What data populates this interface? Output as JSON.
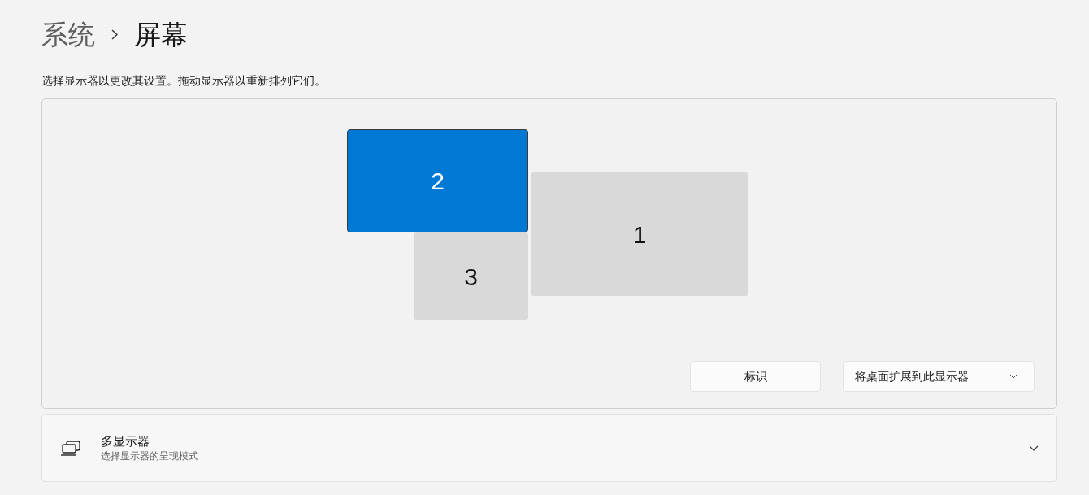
{
  "breadcrumb": {
    "parent": "系统",
    "current": "屏幕"
  },
  "description": "选择显示器以更改其设置。拖动显示器以重新排列它们。",
  "arrangement": {
    "monitors": [
      {
        "label": "2",
        "selected": true
      },
      {
        "label": "1",
        "selected": false
      },
      {
        "label": "3",
        "selected": false
      }
    ],
    "identify_button": {
      "label": "标识"
    },
    "display_mode_dropdown": {
      "value": "将桌面扩展到此显示器"
    }
  },
  "multiple_displays": {
    "title": "多显示器",
    "subtitle": "选择显示器的呈现模式",
    "expanded": false
  }
}
